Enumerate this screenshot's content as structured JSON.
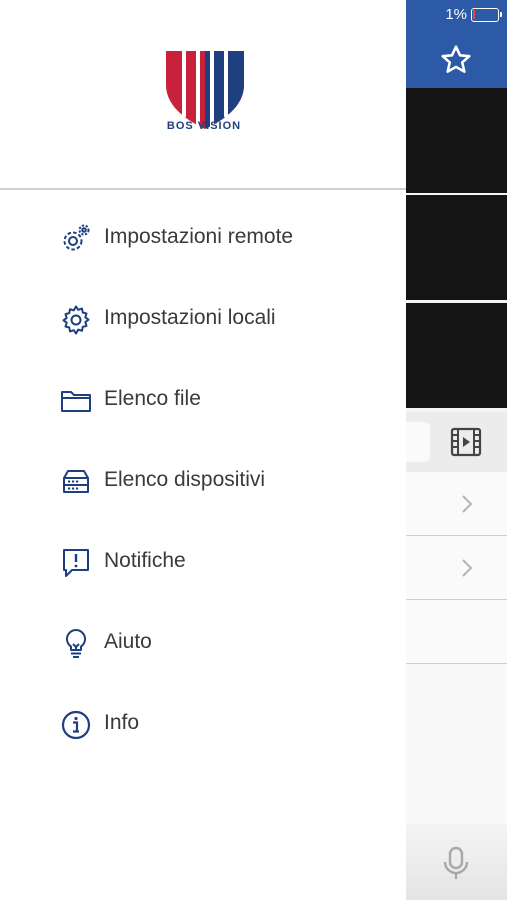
{
  "status": {
    "battery": "1%"
  },
  "brand": {
    "name": "BOS VISION",
    "colors": {
      "red": "#c8213b",
      "navy": "#1f3f7f",
      "header_blue": "#2d5aa6"
    }
  },
  "menu": [
    {
      "label": "Impostazioni remote",
      "icon": "remote-settings-icon"
    },
    {
      "label": "Impostazioni locali",
      "icon": "gear-icon"
    },
    {
      "label": "Elenco file",
      "icon": "folder-icon"
    },
    {
      "label": "Elenco dispositivi",
      "icon": "device-list-icon"
    },
    {
      "label": "Notifiche",
      "icon": "notification-icon"
    },
    {
      "label": "Aiuto",
      "icon": "lightbulb-icon"
    },
    {
      "label": "Info",
      "icon": "info-icon"
    }
  ]
}
